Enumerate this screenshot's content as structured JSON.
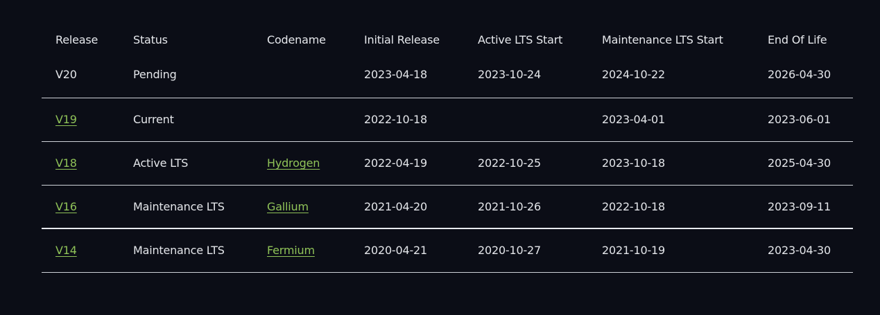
{
  "table": {
    "headers": [
      "Release",
      "Status",
      "Codename",
      "Initial Release",
      "Active LTS Start",
      "Maintenance LTS Start",
      "End Of Life"
    ],
    "rows": [
      {
        "release": "V20",
        "status": "Pending",
        "codename": "",
        "initial": "2023-04-18",
        "active": "2023-10-24",
        "maintenance": "2024-10-22",
        "eol": "2026-04-30"
      },
      {
        "release": "V19",
        "status": "Current",
        "codename": "",
        "initial": "2022-10-18",
        "active": "",
        "maintenance": "2023-04-01",
        "eol": "2023-06-01"
      },
      {
        "release": "V18",
        "status": "Active LTS",
        "codename": "Hydrogen",
        "initial": "2022-04-19",
        "active": "2022-10-25",
        "maintenance": "2023-10-18",
        "eol": "2025-04-30"
      },
      {
        "release": "V16",
        "status": "Maintenance LTS",
        "codename": "Gallium",
        "initial": "2021-04-20",
        "active": "2021-10-26",
        "maintenance": "2022-10-18",
        "eol": "2023-09-11"
      },
      {
        "release": "V14",
        "status": "Maintenance LTS",
        "codename": "Fermium",
        "initial": "2020-04-21",
        "active": "2020-10-27",
        "maintenance": "2021-10-19",
        "eol": "2023-04-30"
      }
    ]
  },
  "colors": {
    "background": "#0b0d16",
    "text": "#e4e6ea",
    "link": "#8fc258",
    "divider": "#cfd2d8"
  }
}
